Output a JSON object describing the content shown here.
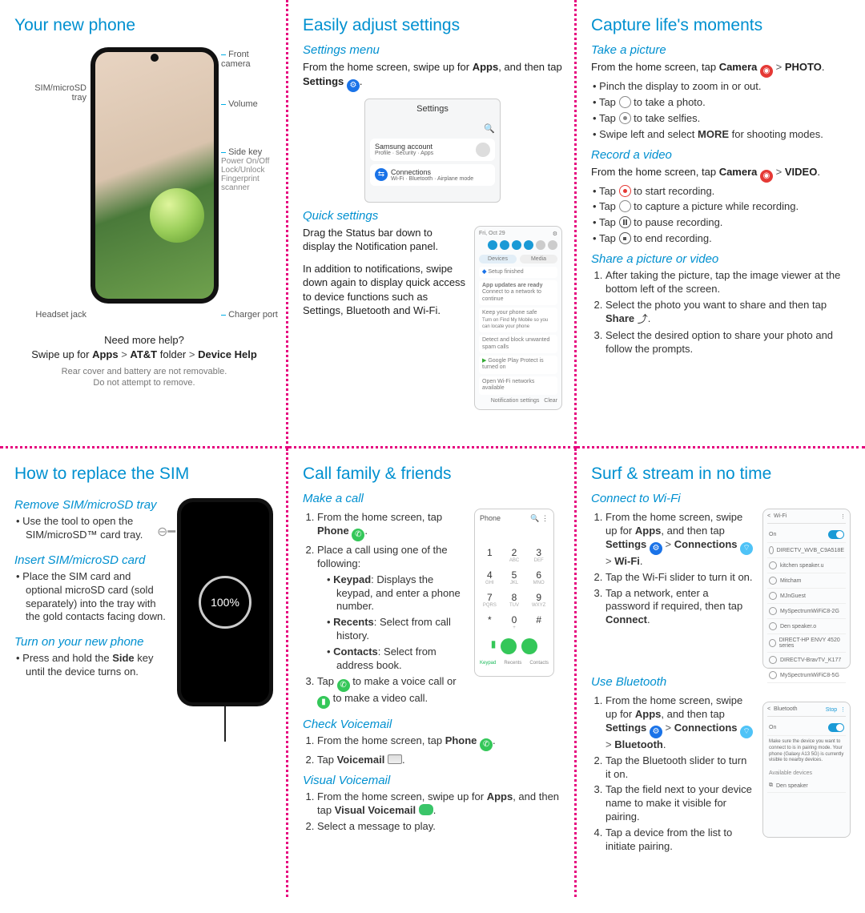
{
  "p1": {
    "title": "Your new phone",
    "labels": {
      "front_camera": "Front camera",
      "sim_tray": "SIM/microSD\ntray",
      "volume": "Volume",
      "side_key": "Side key",
      "side_key_sub": "Power On/Off\nLock/Unlock\nFingerprint scanner",
      "headset": "Headset jack",
      "charger": "Charger port"
    },
    "help_q": "Need more help?",
    "help_path": "Swipe up for Apps > AT&T folder > Device Help",
    "caution1": "Rear cover and battery are not removable.",
    "caution2": "Do not attempt to remove."
  },
  "p2": {
    "title": "Easily adjust settings",
    "h_settings": "Settings menu",
    "settings_text_1": "From the home screen, swipe up for ",
    "settings_bold_apps": "Apps",
    "settings_text_2": ", and then tap ",
    "settings_bold_settings": "Settings",
    "shot_settings_title": "Settings",
    "shot_samsung": "Samsung account",
    "shot_samsung_sub": "Profile · Security · Apps",
    "shot_conn": "Connections",
    "shot_conn_sub": "Wi-Fi · Bluetooth · Airplane mode",
    "h_quick": "Quick settings",
    "quick_p1": "Drag the Status bar down to display the Notification panel.",
    "quick_p2": "In addition to notifications, swipe down again to display quick access to device functions such as Settings, Bluetooth and Wi-Fi.",
    "notif_date": "Fri, Oct 29"
  },
  "p3": {
    "title": "Capture life's moments",
    "h_take": "Take a picture",
    "take_intro_1": "From the home screen, tap ",
    "take_bold_cam": "Camera",
    "take_bold_photo": "PHOTO",
    "bullets_take": [
      "Pinch the display to zoom in or out.",
      "Tap |RING| to take a photo.",
      "Tap |DOTRING| to take selfies.",
      "Swipe left and select |B|MORE|/B| for shooting modes."
    ],
    "h_rec": "Record a video",
    "rec_intro": "From the home screen, tap ",
    "rec_bold_video": "VIDEO",
    "bullets_rec": [
      "Tap |REDDOT| to start recording.",
      "Tap |CAMW| to capture a picture while recording.",
      "Tap |PAUSE| to pause recording.",
      "Tap |SQ| to end recording."
    ],
    "h_share": "Share a picture or video",
    "share_steps": [
      "After taking the picture, tap the image viewer at the bottom left of the screen.",
      "Select the photo you want to share and then tap |B|Share|/B| |SHAREIC|.",
      "Select the desired option to share your photo and follow the prompts."
    ]
  },
  "p4": {
    "title": "How to replace the SIM",
    "h_remove": "Remove SIM/microSD tray",
    "remove_b": "Use the tool to open the SIM/microSD™ card tray.",
    "h_insert": "Insert SIM/microSD card",
    "insert_b": "Place the SIM card and optional microSD card (sold separately) into the tray with the gold contacts facing down.",
    "h_turn": "Turn on your new phone",
    "turn_b_1": "Press and hold the ",
    "turn_bold_side": "Side",
    "turn_b_2": " key until the device turns on.",
    "ring_pct": "100%"
  },
  "p5": {
    "title": "Call family & friends",
    "h_make": "Make a call",
    "make_1_a": "From the home screen, tap ",
    "make_1_bold": "Phone",
    "make_2": "Place a call using one of the following:",
    "make_sub": [
      "|B|Keypad|/B|: Displays the keypad, and enter a phone number.",
      "|B|Recents|/B|: Select from call history.",
      "|B|Contacts|/B|: Select from address book."
    ],
    "make_3": "Tap |GRNCALL| to make a voice call or |GRNVID| to make a video call.",
    "kp": {
      "title": "Phone",
      "tabs": [
        "Keypad",
        "Recents",
        "Contacts"
      ]
    },
    "h_check": "Check Voicemail",
    "check_1": "From the home screen, tap |B|Phone|/B| |GRNCALL|.",
    "check_2": "Tap |B|Voicemail|/B| |VMAIL|.",
    "h_vvm": "Visual Voicemail",
    "vvm_1": "From the home screen, swipe up for |B|Apps|/B|, and then tap |B|Visual Voicemail|/B| |VVM|.",
    "vvm_2": "Select a message to play."
  },
  "p6": {
    "title": "Surf & stream in no time",
    "h_wifi": "Connect to Wi-Fi",
    "wifi_steps": [
      "From the home screen, swipe up for |B|Apps|/B|, and then tap |B|Settings|/B| |BLUEGEAR| > |B|Connections|/B| |CONNIC| > |B|Wi-Fi|/B|.",
      "Tap the Wi-Fi slider to turn it on.",
      "Tap a network, enter a password if required, then tap |B|Connect|/B|."
    ],
    "h_bt": "Use Bluetooth",
    "bt_steps": [
      "From the home screen, swipe up for |B|Apps|/B|, and then tap |B|Settings|/B| |BLUEGEAR| > |B|Connections|/B| |CONNIC| > |B|Bluetooth|/B|.",
      "Tap the Bluetooth slider to turn it on.",
      "Tap the field next to your device name to make it visible for pairing.",
      "Tap a device from the list to initiate pairing."
    ],
    "wifi_shot_title": "Wi-Fi",
    "bt_shot_title": "Bluetooth"
  }
}
